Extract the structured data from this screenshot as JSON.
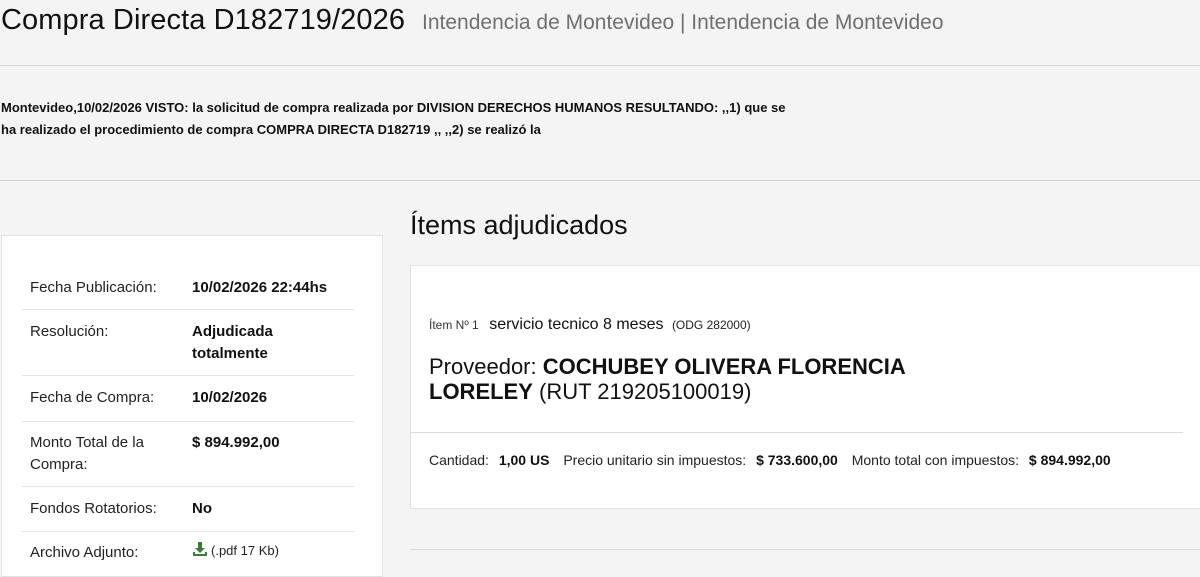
{
  "header": {
    "title": "Compra Directa D182719/2026",
    "subtitle": "Intendencia de Montevideo | Intendencia de Montevideo"
  },
  "intro": {
    "text": "Montevideo,10/02/2026 VISTO: la solicitud de compra realizada por DIVISION DERECHOS HUMANOS RESULTANDO: ,,1) que se ha realizado el procedimiento de compra COMPRA DIRECTA D182719 ,, ,,2) se realizó la"
  },
  "info": {
    "fecha_publicacion": {
      "label": "Fecha Publicación:",
      "value": "10/02/2026 22:44hs"
    },
    "resolucion": {
      "label": "Resolución:",
      "value": "Adjudicada totalmente"
    },
    "fecha_compra": {
      "label": "Fecha de Compra:",
      "value": "10/02/2026"
    },
    "monto_total": {
      "label": "Monto Total de la Compra:",
      "value": "$ 894.992,00"
    },
    "fondos_rotatorios": {
      "label": "Fondos Rotatorios:",
      "value": "No"
    },
    "archivo_adjunto": {
      "label": "Archivo Adjunto:",
      "link": "(.pdf 17 Kb)",
      "icon": "download-icon"
    }
  },
  "items_section": {
    "title": "Ítems adjudicados"
  },
  "item": {
    "number": "Ítem Nº 1",
    "description": "servicio tecnico 8 meses",
    "odg": "(ODG 282000)",
    "provider_label": "Proveedor:",
    "provider_name": "COCHUBEY OLIVERA FLORENCIA LORELEY",
    "provider_rut": "(RUT 219205100019)",
    "cantidad_label": "Cantidad:",
    "cantidad_value": "1,00 US",
    "precio_label": "Precio unitario sin impuestos:",
    "precio_value": "$ 733.600,00",
    "monto_label": "Monto total con impuestos:",
    "monto_value": "$ 894.992,00"
  },
  "colors": {
    "background": "#f3f4f3",
    "card": "#ffffff",
    "subtitle": "#707070",
    "download_icon": "#3f7a3a"
  }
}
